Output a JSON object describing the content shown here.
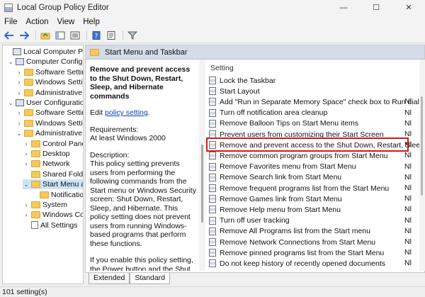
{
  "window": {
    "title": "Local Group Policy Editor",
    "controls": [
      "—",
      "☐",
      "✕"
    ]
  },
  "menu": [
    "File",
    "Action",
    "View",
    "Help"
  ],
  "tree": [
    {
      "label": "Local Computer Policy",
      "level": 0,
      "chevron": "",
      "icon": "node"
    },
    {
      "label": "Computer Configuration",
      "level": 1,
      "chevron": "⌄",
      "icon": "node"
    },
    {
      "label": "Software Settings",
      "level": 2,
      "chevron": "›",
      "icon": "folder"
    },
    {
      "label": "Windows Settings",
      "level": 2,
      "chevron": "›",
      "icon": "folder"
    },
    {
      "label": "Administrative Templates",
      "level": 2,
      "chevron": "›",
      "icon": "folder"
    },
    {
      "label": "User Configuration",
      "level": 1,
      "chevron": "⌄",
      "icon": "node"
    },
    {
      "label": "Software Settings",
      "level": 2,
      "chevron": "›",
      "icon": "folder"
    },
    {
      "label": "Windows Settings",
      "level": 2,
      "chevron": "›",
      "icon": "folder"
    },
    {
      "label": "Administrative Templates",
      "level": 2,
      "chevron": "⌄",
      "icon": "folder"
    },
    {
      "label": "Control Panel",
      "level": 3,
      "chevron": "›",
      "icon": "folder"
    },
    {
      "label": "Desktop",
      "level": 3,
      "chevron": "›",
      "icon": "folder"
    },
    {
      "label": "Network",
      "level": 3,
      "chevron": "›",
      "icon": "folder"
    },
    {
      "label": "Shared Folders",
      "level": 3,
      "chevron": "",
      "icon": "folder"
    },
    {
      "label": "Start Menu and Taskbar",
      "level": 3,
      "chevron": "⌄",
      "icon": "folder",
      "selected": true
    },
    {
      "label": "Notifications",
      "level": 4,
      "chevron": "",
      "icon": "folder"
    },
    {
      "label": "System",
      "level": 3,
      "chevron": "›",
      "icon": "folder"
    },
    {
      "label": "Windows Components",
      "level": 3,
      "chevron": "›",
      "icon": "folder"
    },
    {
      "label": "All Settings",
      "level": 3,
      "chevron": "",
      "icon": "doc"
    }
  ],
  "pane": {
    "header": "Start Menu and Taskbar",
    "desc_title": "Remove and prevent access to the Shut Down, Restart, Sleep, and Hibernate commands",
    "edit_prefix": "Edit ",
    "edit_link": "policy setting",
    "edit_suffix": ".",
    "requirements_label": "Requirements:",
    "requirements_value": "At least Windows 2000",
    "description_label": "Description:",
    "description_body": "This policy setting prevents users from performing the following commands from the Start menu or Windows Security screen: Shut Down, Restart, Sleep, and Hibernate. This policy setting does not prevent users from running Windows-based programs that perform these functions.",
    "enable_text": "If you enable this policy setting, the Power button and the Shut Down, Restart, Sleep, and Hibernate commands are removed from the Start menu. The"
  },
  "list": {
    "column_header": "Setting",
    "rows": [
      {
        "label": "Lock the Taskbar",
        "state": ""
      },
      {
        "label": "Start Layout",
        "state": ""
      },
      {
        "label": "Add \"Run in Separate Memory Space\" check box to Run dial...",
        "state": "Nl"
      },
      {
        "label": "Turn off notification area cleanup",
        "state": "Nl"
      },
      {
        "label": "Remove Balloon Tips on Start Menu items",
        "state": "Nl"
      },
      {
        "label": "Prevent users from customizing their Start Screen",
        "state": "Nl"
      },
      {
        "label": "Remove and prevent access to the Shut Down, Restart, Sleep...",
        "state": "Nl",
        "highlighted": true
      },
      {
        "label": "Remove common program groups from Start Menu",
        "state": "Nl"
      },
      {
        "label": "Remove Favorites menu from Start Menu",
        "state": "Nl"
      },
      {
        "label": "Remove Search link from Start Menu",
        "state": "Nl"
      },
      {
        "label": "Remove frequent programs list from the Start Menu",
        "state": "Nl"
      },
      {
        "label": "Remove Games link from Start Menu",
        "state": "Nl"
      },
      {
        "label": "Remove Help menu from Start Menu",
        "state": "Nl"
      },
      {
        "label": "Turn off user tracking",
        "state": "Nl"
      },
      {
        "label": "Remove All Programs list from the Start menu",
        "state": "Nl"
      },
      {
        "label": "Remove Network Connections from Start Menu",
        "state": "Nl"
      },
      {
        "label": "Remove pinned programs list from the Start Menu",
        "state": "Nl"
      },
      {
        "label": "Do not keep history of recently opened documents",
        "state": "Nl"
      }
    ]
  },
  "tabs": [
    "Extended",
    "Standard"
  ],
  "status": "101 setting(s)",
  "colors": {
    "highlight_border": "#d21919",
    "selected_tree": "#cce4f7",
    "link": "#0645ad"
  }
}
